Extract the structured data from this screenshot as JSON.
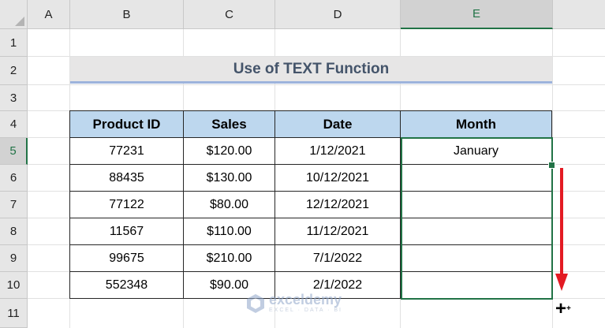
{
  "columns": [
    "A",
    "B",
    "C",
    "D",
    "E"
  ],
  "rows": [
    "1",
    "2",
    "3",
    "4",
    "5",
    "6",
    "7",
    "8",
    "9",
    "10",
    "11"
  ],
  "title": "Use of TEXT Function",
  "table": {
    "headers": [
      "Product ID",
      "Sales",
      "Date",
      "Month"
    ],
    "rows": [
      [
        "77231",
        "$120.00",
        "1/12/2021",
        "January"
      ],
      [
        "88435",
        "$130.00",
        "10/12/2021",
        ""
      ],
      [
        "77122",
        "$80.00",
        "12/12/2021",
        ""
      ],
      [
        "11567",
        "$110.00",
        "11/12/2021",
        ""
      ],
      [
        "99675",
        "$210.00",
        "7/1/2022",
        ""
      ],
      [
        "552348",
        "$90.00",
        "2/1/2022",
        ""
      ]
    ]
  },
  "selection": {
    "active_column": "E",
    "active_row": "5"
  },
  "colors": {
    "header_fill": "#bdd7ee",
    "title_fill": "#e7e6e6",
    "title_text": "#44546a",
    "selection": "#217346",
    "arrow": "#e31b23"
  },
  "cursor_icon": "crosshair-plus-icon",
  "watermark": {
    "brand": "exceldemy",
    "tagline": "EXCEL · DATA · BI"
  }
}
